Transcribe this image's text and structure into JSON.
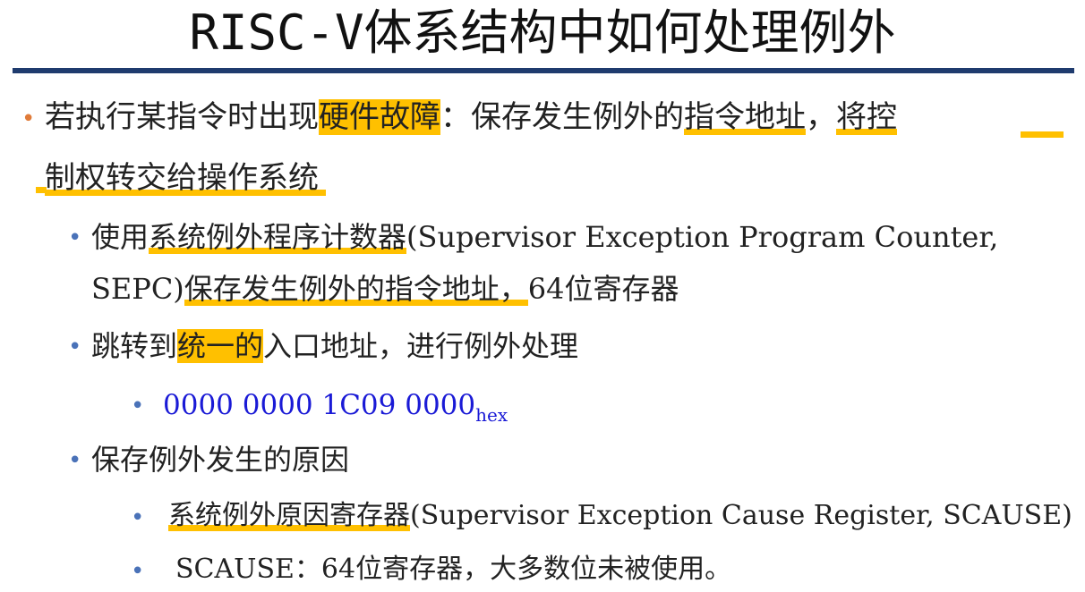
{
  "slide": {
    "title": "RISC-V体系结构中如何处理例外",
    "colors": {
      "rule": "#1f3b6e",
      "highlight": "#ffc000",
      "bullet_l1": "#e07b39",
      "bullet_l2": "#4a72b8",
      "hex_text": "#1a1ad6"
    },
    "bullet1": {
      "pre": "若执行某指令时出现",
      "hl1": "硬件故障",
      "mid": "：保存发生例外的",
      "ul1": "指令地址",
      "comma": "，",
      "ul2": "将控",
      "line2": "制权转交给操作系统"
    },
    "bullet2": {
      "pre": "使用",
      "ul1": "系统例外程序计数器",
      "post1": "(Supervisor Exception Program Counter,",
      "line2_pre": "SEPC)",
      "ul2": "保存发生例外的指令地址，",
      "line2_post": "64位寄存器"
    },
    "bullet3": {
      "pre": "跳转到",
      "hl": "统一的",
      "post": "入口地址，进行例外处理"
    },
    "bullet3a": {
      "value": "0000 0000 1C09 0000",
      "sub": "hex"
    },
    "bullet4": {
      "text": "保存例外发生的原因"
    },
    "bullet4a": {
      "ul": "系统例外原因寄存器",
      "post": "(Supervisor Exception Cause Register, SCAUSE)"
    },
    "bullet4b": {
      "text": "SCAUSE：64位寄存器，大多数位未被使用。"
    },
    "bullet_glyph": "•"
  }
}
